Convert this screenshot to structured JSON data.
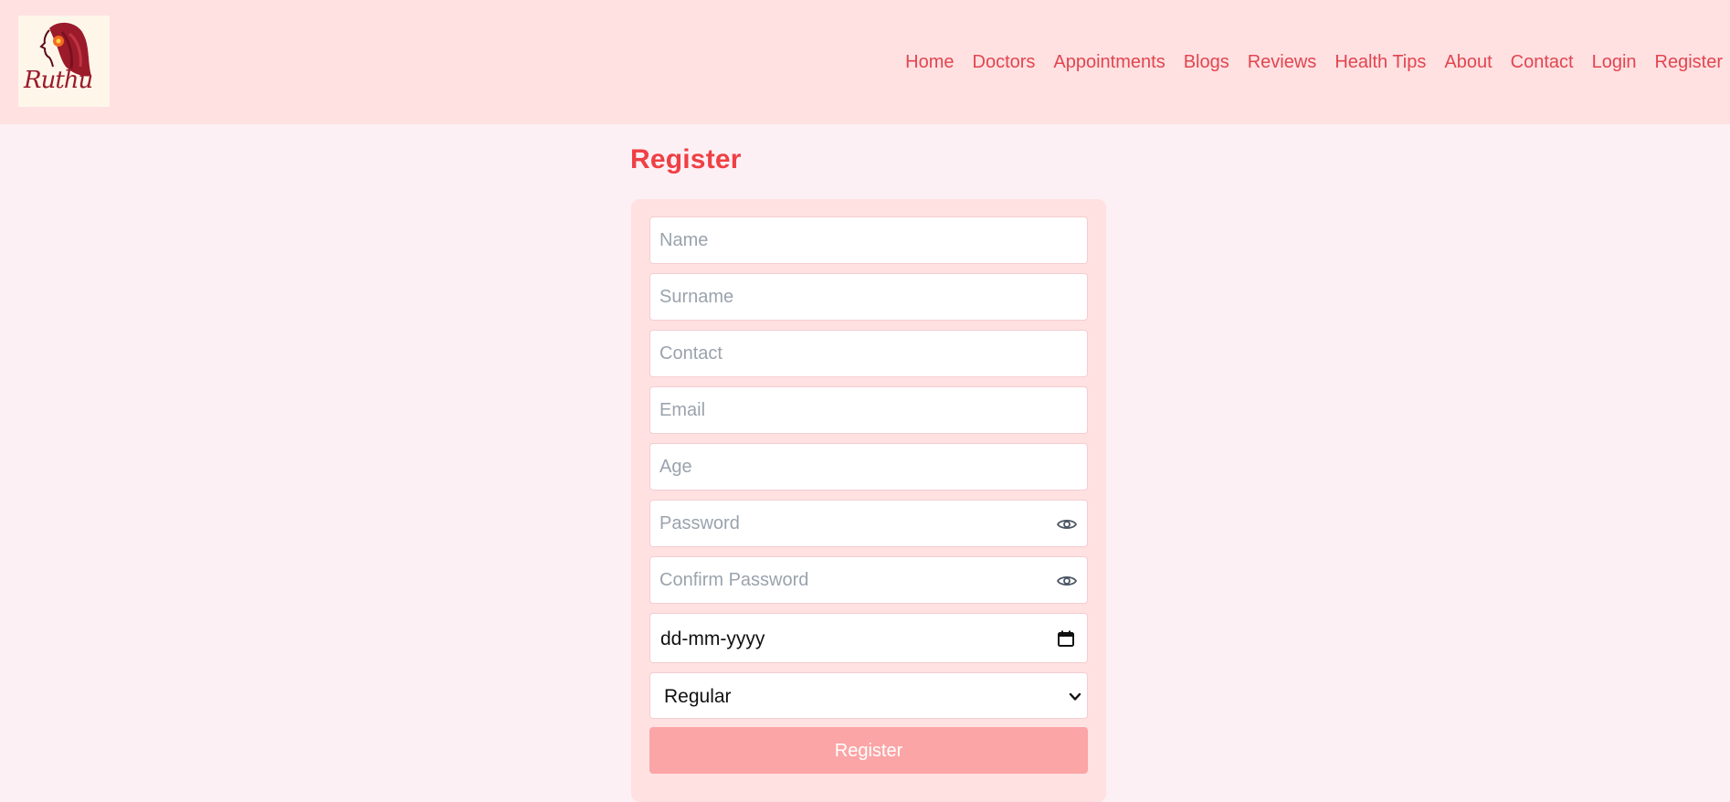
{
  "brand": {
    "logo_text": "Ruthu"
  },
  "nav": {
    "items": [
      "Home",
      "Doctors",
      "Appointments",
      "Blogs",
      "Reviews",
      "Health Tips",
      "About",
      "Contact",
      "Login",
      "Register"
    ]
  },
  "page": {
    "title": "Register"
  },
  "form": {
    "name_placeholder": "Name",
    "surname_placeholder": "Surname",
    "contact_placeholder": "Contact",
    "email_placeholder": "Email",
    "age_placeholder": "Age",
    "password_placeholder": "Password",
    "confirm_password_placeholder": "Confirm Password",
    "date_value": "dd-mm-yyyy",
    "plan_selected": "Regular",
    "submit_label": "Register"
  },
  "colors": {
    "navbar_bg": "#ffe1e2",
    "page_bg": "#fdf0f5",
    "accent": "#ef4044",
    "nav_link": "#e2454f",
    "button_bg": "#fba5a6"
  }
}
